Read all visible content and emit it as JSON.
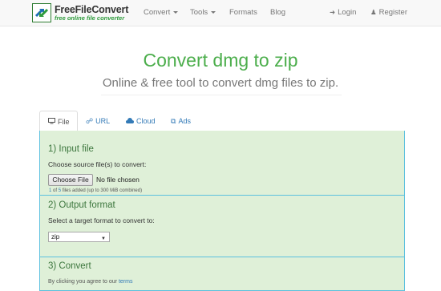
{
  "brand": {
    "name": "FreeFileConvert",
    "tagline": "free online file converter"
  },
  "nav": {
    "convert": "Convert",
    "tools": "Tools",
    "formats": "Formats",
    "blog": "Blog",
    "login": "Login",
    "register": "Register"
  },
  "header": {
    "title": "Convert dmg to zip",
    "subtitle": "Online & free tool to convert dmg files to zip."
  },
  "tabs": [
    {
      "label": "File",
      "icon": "monitor-icon",
      "active": true
    },
    {
      "label": "URL",
      "icon": "link-icon",
      "active": false
    },
    {
      "label": "Cloud",
      "icon": "cloud-upload-icon",
      "active": false
    },
    {
      "label": "Ads",
      "icon": "external-link-icon",
      "active": false
    }
  ],
  "input_section": {
    "title": "1) Input file",
    "instruction": "Choose source file(s) to convert:",
    "choose_button": "Choose File",
    "file_status": "No file chosen",
    "files_added": "1",
    "files_of": "of",
    "files_max": "5",
    "files_suffix": "files added (up to 300 MiB combined)"
  },
  "output_section": {
    "title": "2) Output format",
    "instruction": "Select a target format to convert to:",
    "selected_format": "zip"
  },
  "convert_section": {
    "title": "3) Convert",
    "agree_text": "By clicking you agree to our",
    "terms_link": "terms"
  },
  "colors": {
    "accent_green": "#4cae4c",
    "panel_bg": "#dff0d8",
    "panel_border": "#5bc0de",
    "link_blue": "#337ab7"
  }
}
